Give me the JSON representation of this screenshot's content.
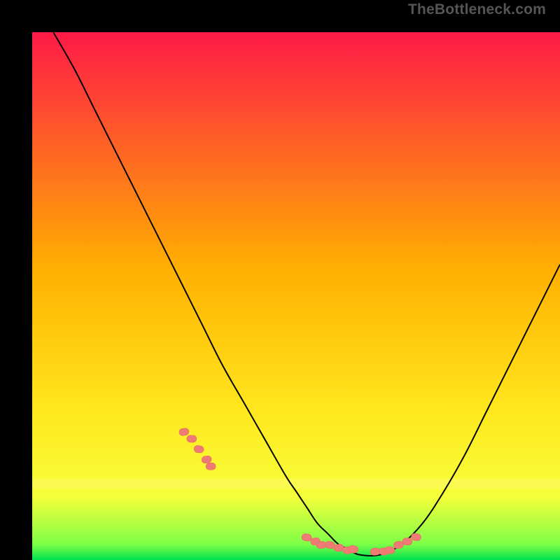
{
  "watermark": "TheBottleneck.com",
  "colors": {
    "gradient_top": "#fe1a47",
    "gradient_mid": "#ffc400",
    "gradient_low": "#fff92a",
    "gradient_bottom": "#00e24e",
    "frame": "#000000",
    "curve": "#000000",
    "marker_fill": "#ef7b75",
    "marker_stroke": "#e86a64"
  },
  "chart_data": {
    "type": "line",
    "title": "",
    "xlabel": "",
    "ylabel": "",
    "xlim": [
      0,
      100
    ],
    "ylim": [
      0,
      100
    ],
    "series": [
      {
        "name": "bottleneck-curve",
        "x": [
          4,
          8,
          12,
          16,
          20,
          24,
          28,
          32,
          36,
          40,
          44,
          48,
          50,
          52,
          54,
          56,
          58,
          60,
          62,
          66,
          70,
          74,
          78,
          82,
          86,
          90,
          94,
          98,
          100
        ],
        "y": [
          100,
          93,
          85,
          77,
          69,
          61,
          53,
          45,
          37,
          30,
          23,
          16,
          13,
          10,
          7,
          5,
          3,
          2,
          1,
          1,
          3,
          7,
          13,
          20,
          28,
          36,
          44,
          52,
          56
        ]
      }
    ],
    "markers": {
      "name": "highlight-dots",
      "x": [
        29,
        30.3,
        31.5,
        32.8,
        34,
        52,
        53.5,
        55,
        56.5,
        58,
        59.5,
        61,
        65,
        66.5,
        68,
        69.5,
        71,
        72.5
      ],
      "y": [
        24.5,
        22.8,
        21,
        19.2,
        17.5,
        4.2,
        3.6,
        3.1,
        2.7,
        2.3,
        2.0,
        1.8,
        1.5,
        1.7,
        2.1,
        2.7,
        3.5,
        4.5
      ]
    }
  }
}
